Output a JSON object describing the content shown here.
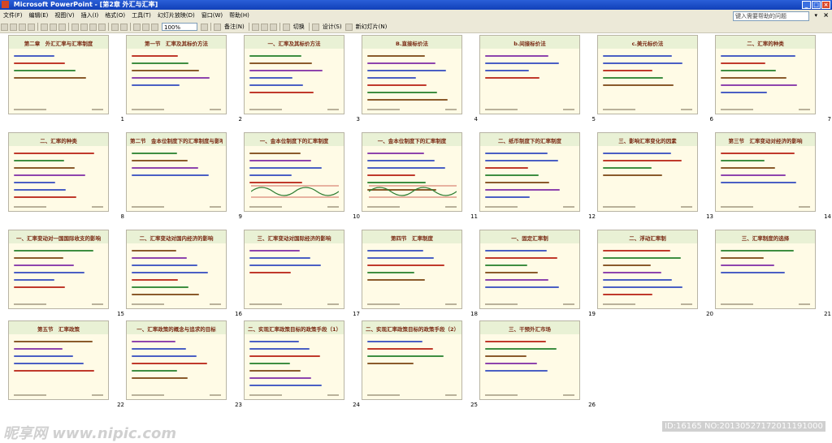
{
  "window": {
    "title": "Microsoft PowerPoint - [第2章 外汇与汇率]",
    "buttons": [
      "_",
      "□",
      "×"
    ]
  },
  "menu": {
    "items": [
      "文件(F)",
      "编辑(E)",
      "视图(V)",
      "插入(I)",
      "格式(O)",
      "工具(T)",
      "幻灯片放映(D)",
      "窗口(W)",
      "帮助(H)"
    ],
    "help_placeholder": "键入需要帮助的问题",
    "close_label": "×"
  },
  "toolbar": {
    "zoom": "100%",
    "notes_label": "备注(N)",
    "switch_label": "切换",
    "design_label": "设计(S)",
    "new_slide_label": "新幻灯片(N)"
  },
  "slides": [
    {
      "num": "1",
      "title": "第二章　外汇汇率与汇率制度"
    },
    {
      "num": "2",
      "title": "第一节　汇率及其标价方法"
    },
    {
      "num": "3",
      "title": "一、汇率及其标价方法"
    },
    {
      "num": "4",
      "title": "B.直接标价法"
    },
    {
      "num": "5",
      "title": "b.间接标价法"
    },
    {
      "num": "6",
      "title": "c.美元标价法"
    },
    {
      "num": "7",
      "title": "二、汇率的种类"
    },
    {
      "num": "8",
      "title": "二、汇率的种类"
    },
    {
      "num": "9",
      "title": "第二节　金本位制度下的汇率制度与影响汇率变化的因素"
    },
    {
      "num": "10",
      "title": "一、金本位制度下的汇率制度"
    },
    {
      "num": "11",
      "title": "一、金本位制度下的汇率制度"
    },
    {
      "num": "12",
      "title": "二、纸币制度下的汇率制度"
    },
    {
      "num": "13",
      "title": "三、影响汇率变化的因素"
    },
    {
      "num": "14",
      "title": "第三节　汇率变动对经济的影响"
    },
    {
      "num": "15",
      "title": "一、汇率变动对一国国际收支的影响"
    },
    {
      "num": "16",
      "title": "二、汇率变动对国内经济的影响"
    },
    {
      "num": "17",
      "title": "三、汇率变动对国际经济的影响"
    },
    {
      "num": "18",
      "title": "第四节　汇率制度"
    },
    {
      "num": "19",
      "title": "一、固定汇率制"
    },
    {
      "num": "20",
      "title": "二、浮动汇率制"
    },
    {
      "num": "21",
      "title": "三、汇率制度的选择"
    },
    {
      "num": "22",
      "title": "第五节　汇率政策"
    },
    {
      "num": "23",
      "title": "一、汇率政策的概念与追求的目标"
    },
    {
      "num": "24",
      "title": "二、实现汇率政策目标的政策手段（1）"
    },
    {
      "num": "25",
      "title": "二、实现汇率政策目标的政策手段（2）"
    },
    {
      "num": "26",
      "title": "三、干预外汇市场"
    }
  ],
  "watermark": {
    "left": "昵享网 www.nipic.com",
    "right": "ID:16165 NO:20130527172011191000"
  }
}
